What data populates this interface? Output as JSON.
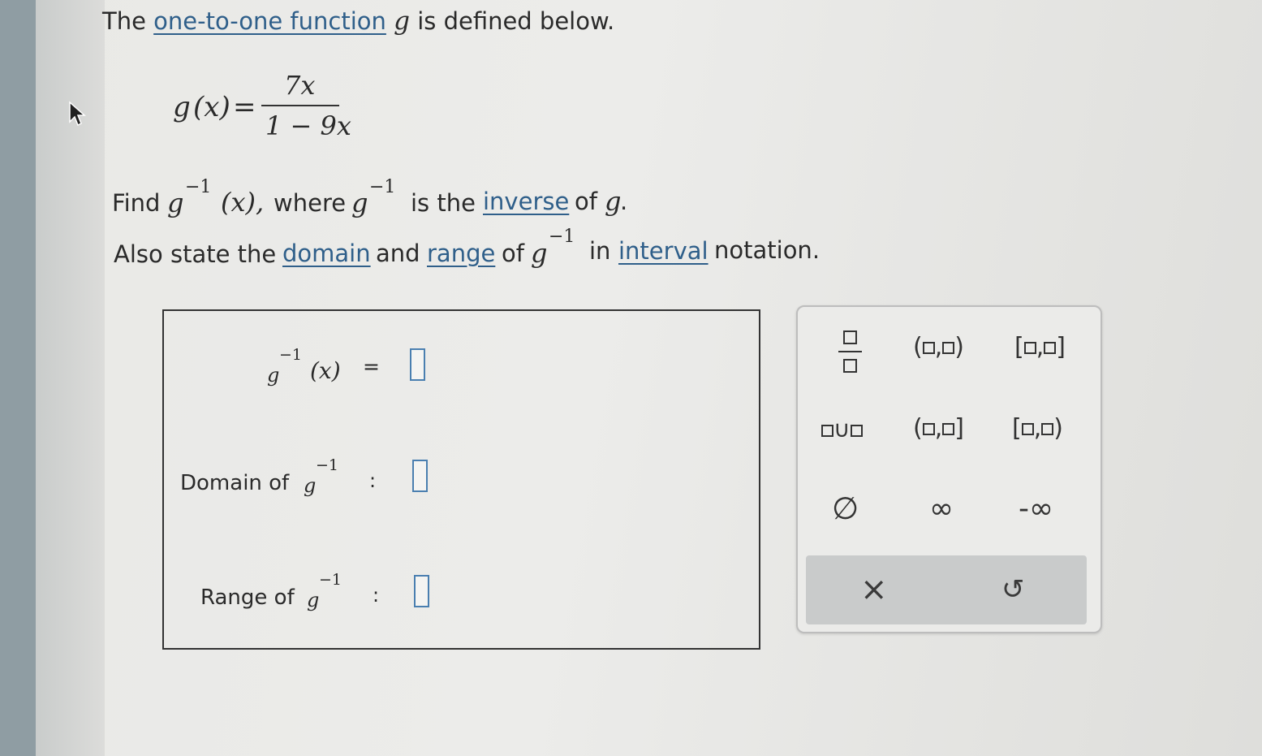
{
  "intro": {
    "prefix": "The",
    "link": "one-to-one function",
    "var": "g",
    "suffix": "is defined below."
  },
  "definition": {
    "lhs_g": "g",
    "lhs_arg": "(x)",
    "equals": "=",
    "numerator": "7x",
    "denominator": "1 − 9x"
  },
  "find_line": {
    "find": "Find",
    "g": "g",
    "exp": "−1",
    "arg": "(x),",
    "where": "where",
    "g2": "g",
    "exp2": "−1",
    "is_the": "is the",
    "link": "inverse",
    "of": "of",
    "g3": "g",
    "period": "."
  },
  "also_line": {
    "also": "Also state the",
    "link_domain": "domain",
    "and": "and",
    "link_range": "range",
    "of": "of",
    "g": "g",
    "exp": "−1",
    "in": "in",
    "link_interval": "interval",
    "notation": "notation."
  },
  "answers": {
    "inverse": {
      "g": "g",
      "exp": "−1",
      "arg": "(x)",
      "sep": "="
    },
    "domain": {
      "label": "Domain of",
      "g": "g",
      "exp": "−1",
      "sep": ":"
    },
    "range": {
      "label": "Range of",
      "g": "g",
      "exp": "−1",
      "sep": ":"
    }
  },
  "palette": {
    "open_open": {
      "open": "(",
      "comma": ",",
      "close": ")"
    },
    "closed_closed": {
      "open": "[",
      "comma": ",",
      "close": "]"
    },
    "open_closed": {
      "open": "(",
      "comma": ",",
      "close": "]"
    },
    "closed_open": {
      "open": "[",
      "comma": ",",
      "close": ")"
    },
    "union": "∪",
    "empty_set": "∅",
    "infinity": "∞",
    "neg_infinity": "-∞",
    "clear": "×",
    "undo": "↺"
  },
  "colors": {
    "link": "#2f5f8a",
    "slot_border": "#4a7fb0",
    "action_bar": "#c9cbcb"
  }
}
